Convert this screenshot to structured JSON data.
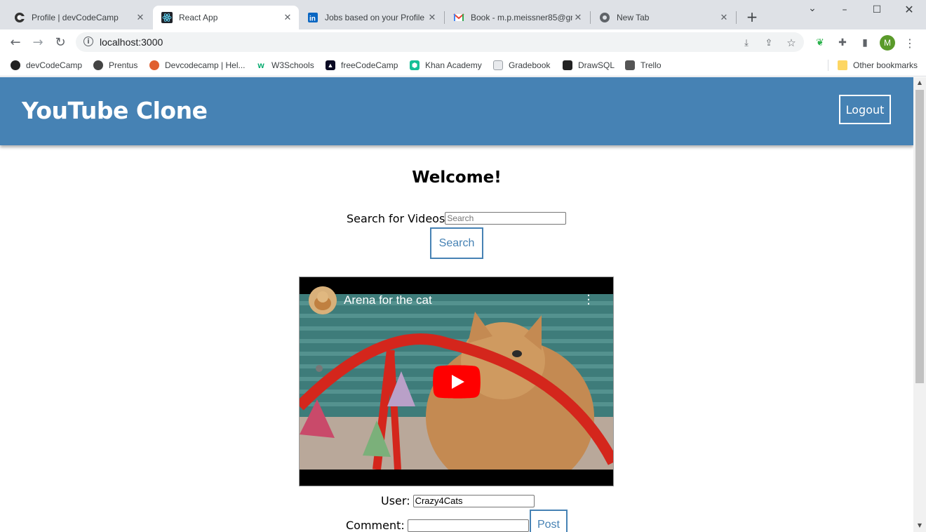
{
  "browser": {
    "tabs": [
      {
        "title": "Profile | devCodeCamp",
        "favicon": "devcodecamp-icon"
      },
      {
        "title": "React App",
        "favicon": "react-icon"
      },
      {
        "title": "Jobs based on your Profile",
        "favicon": "linkedin-icon"
      },
      {
        "title": "Book - m.p.meissner85@gm",
        "favicon": "gmail-icon"
      },
      {
        "title": "New Tab",
        "favicon": "chrome-icon"
      }
    ],
    "active_tab": 1,
    "url": "localhost:3000",
    "avatar_letter": "M",
    "bookmarks": [
      {
        "label": "devCodeCamp",
        "color": "#222222"
      },
      {
        "label": "Prentus",
        "color": "#444444"
      },
      {
        "label": "Devcodecamp | Hel...",
        "color": "#e06030"
      },
      {
        "label": "W3Schools",
        "color": "#04aa6d"
      },
      {
        "label": "freeCodeCamp",
        "color": "#0a0a23"
      },
      {
        "label": "Khan Academy",
        "color": "#14bf96"
      },
      {
        "label": "Gradebook",
        "color": "#9aa0a6"
      },
      {
        "label": "DrawSQL",
        "color": "#222222"
      },
      {
        "label": "Trello",
        "color": "#555555"
      }
    ],
    "other_bookmarks": "Other bookmarks"
  },
  "app": {
    "title": "YouTube Clone",
    "logout_label": "Logout",
    "welcome": "Welcome!",
    "search": {
      "label": "Search for Videos",
      "placeholder": "Search",
      "button_label": "Search"
    },
    "video": {
      "title": "Arena for the cat"
    },
    "comment_form": {
      "user_label": "User:",
      "user_value": "Crazy4Cats",
      "comment_label": "Comment:",
      "comment_value": "",
      "post_label": "Post"
    },
    "colors": {
      "header": "#4682b4",
      "accent": "#4682b4"
    }
  }
}
